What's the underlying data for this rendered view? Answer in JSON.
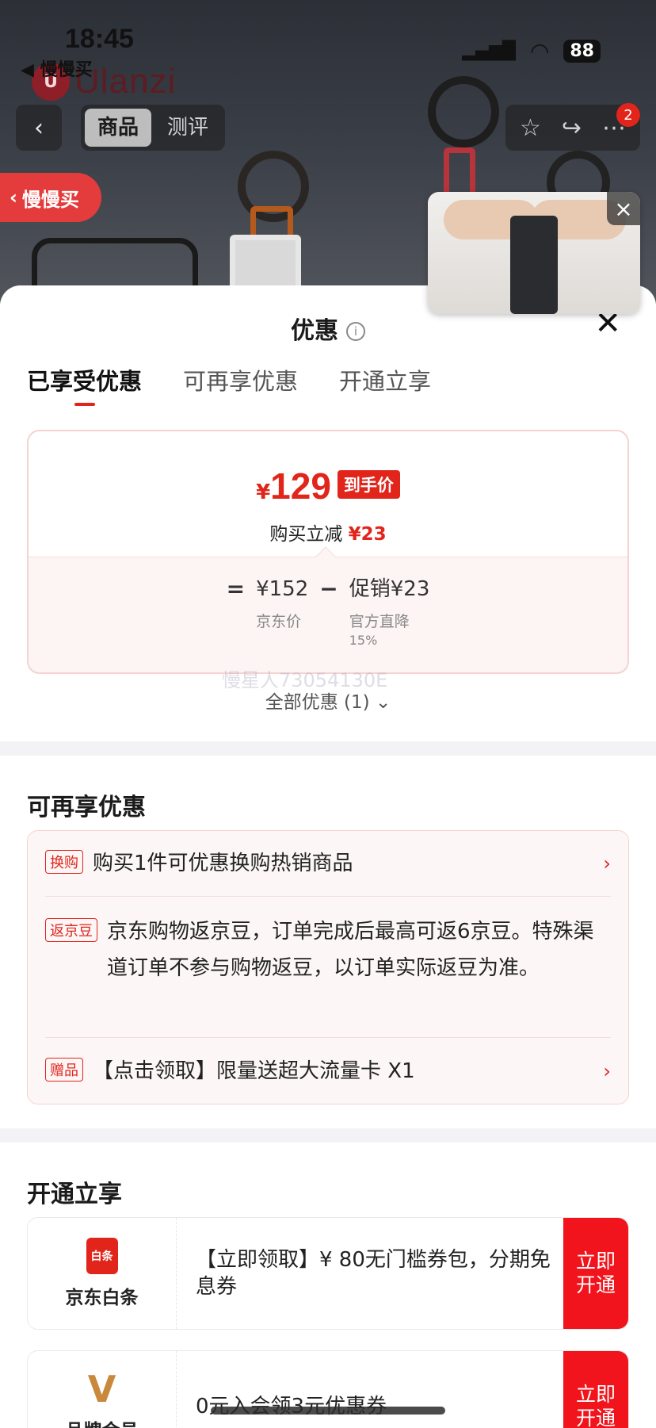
{
  "status_bar": {
    "time": "18:45",
    "back_app": "◀ 慢慢买",
    "battery": "88"
  },
  "hero": {
    "brand": "Ulanzi"
  },
  "nav": {
    "tabs": [
      {
        "label": "商品"
      },
      {
        "label": "测评"
      }
    ],
    "cart_count": "2"
  },
  "slow_buy": {
    "label": "慢慢买"
  },
  "sheet": {
    "title": "优惠",
    "tabs": [
      {
        "label": "已享受优惠"
      },
      {
        "label": "可再享优惠"
      },
      {
        "label": "开通立享"
      }
    ],
    "final_price": {
      "currency": "¥",
      "amount": "129",
      "badge": "到手价"
    },
    "reduce": {
      "label": "购买立减",
      "amount": "¥23"
    },
    "formula": {
      "eq": "=",
      "minus": "−",
      "jd_price": "¥152",
      "jd_price_label": "京东价",
      "promo": "促销¥23",
      "promo_label": "官方直降",
      "promo_sub": "15%"
    },
    "watermark": "慢星人73054130E",
    "all_deals": "全部优惠 (1) ⌄"
  },
  "more_deals": {
    "title": "可再享优惠",
    "items": [
      {
        "tag": "换购",
        "text": "购买1件可优惠换购热销商品",
        "arrow": "›"
      },
      {
        "tag": "返京豆",
        "text": "京东购物返京豆，订单完成后最高可返6京豆。特殊渠道订单不参与购物返豆，以订单实际返豆为准。"
      },
      {
        "tag": "赠品",
        "text": "【点击领取】限量送超大流量卡 X1",
        "arrow": "›"
      }
    ]
  },
  "open_now": {
    "title": "开通立享",
    "cards": [
      {
        "icon_label": "白条",
        "name": "京东白条",
        "text": "【立即领取】¥ 80无门槛券包，分期免息券",
        "button": "立即开通"
      },
      {
        "icon_label": "V",
        "name": "品牌会员",
        "text": "0元入会领3元优惠券",
        "button": "立即开通"
      }
    ]
  },
  "colors": {
    "accent": "#e1251b",
    "sheet_bg": "#ffffff",
    "hero_bg": "#3a3e46"
  }
}
